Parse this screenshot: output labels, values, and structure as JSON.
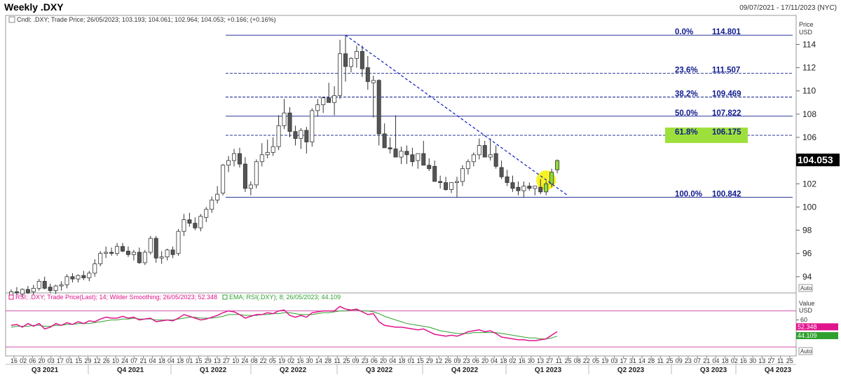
{
  "header": {
    "title": "Weekly .DXY",
    "date_range": "09/07/2021 - 17/11/2023 (NYC)"
  },
  "chart_data": [
    {
      "type": "candlestick",
      "legend": "Cndl; .DXY; Trade Price; 26/05/2023; 103.193; 104.061; 102.964; 104.053; +0.166; (+0.16%)",
      "axis_title": [
        "Price",
        "USD"
      ],
      "yticks": [
        94,
        96,
        98,
        100,
        102,
        104,
        106,
        108,
        110,
        112,
        114
      ],
      "ylim": [
        92.6,
        116.5
      ],
      "auto_label": "Auto",
      "last_price": {
        "label": "104.053",
        "value": 104.053
      },
      "candles": [
        [
          92.3,
          92.9,
          92.1,
          92.7
        ],
        [
          92.7,
          93.1,
          92.4,
          92.6
        ],
        [
          92.5,
          93.0,
          92.2,
          92.9
        ],
        [
          92.9,
          93.2,
          92.5,
          92.6
        ],
        [
          92.7,
          93.3,
          92.4,
          93.0
        ],
        [
          93.0,
          93.8,
          92.8,
          93.6
        ],
        [
          93.6,
          94.0,
          92.9,
          93.0
        ],
        [
          93.1,
          93.4,
          92.6,
          92.8
        ],
        [
          92.8,
          93.3,
          92.5,
          93.2
        ],
        [
          93.2,
          93.6,
          92.8,
          93.3
        ],
        [
          93.3,
          94.2,
          93.0,
          94.0
        ],
        [
          94.0,
          94.3,
          93.5,
          93.8
        ],
        [
          93.8,
          94.2,
          93.5,
          94.1
        ],
        [
          94.1,
          94.5,
          93.7,
          93.9
        ],
        [
          93.9,
          94.5,
          93.6,
          94.3
        ],
        [
          94.3,
          95.5,
          94.0,
          95.1
        ],
        [
          95.1,
          96.2,
          94.9,
          96.0
        ],
        [
          96.0,
          96.6,
          95.6,
          96.1
        ],
        [
          96.1,
          96.5,
          95.8,
          96.0
        ],
        [
          96.0,
          96.9,
          95.8,
          96.6
        ],
        [
          96.6,
          96.9,
          96.1,
          96.2
        ],
        [
          96.2,
          96.6,
          95.7,
          95.9
        ],
        [
          95.9,
          96.3,
          95.4,
          96.1
        ],
        [
          96.1,
          96.5,
          95.1,
          95.2
        ],
        [
          95.2,
          96.3,
          95.0,
          96.1
        ],
        [
          96.1,
          97.5,
          95.9,
          97.3
        ],
        [
          97.3,
          97.5,
          95.2,
          95.6
        ],
        [
          95.6,
          96.2,
          95.1,
          95.7
        ],
        [
          95.7,
          96.4,
          95.4,
          96.3
        ],
        [
          96.3,
          96.6,
          95.6,
          95.9
        ],
        [
          96.0,
          98.1,
          95.8,
          97.9
        ],
        [
          97.9,
          99.4,
          97.5,
          98.9
        ],
        [
          98.9,
          99.5,
          98.3,
          98.6
        ],
        [
          98.6,
          99.1,
          98.0,
          98.2
        ],
        [
          98.2,
          99.4,
          97.9,
          99.2
        ],
        [
          99.1,
          100.0,
          98.7,
          99.8
        ],
        [
          99.8,
          100.9,
          99.5,
          100.6
        ],
        [
          100.6,
          101.8,
          100.3,
          101.1
        ],
        [
          101.2,
          103.7,
          101.0,
          103.6
        ],
        [
          103.6,
          104.4,
          103.0,
          104.0
        ],
        [
          104.0,
          105.0,
          103.5,
          104.6
        ],
        [
          104.6,
          105.1,
          103.4,
          103.7
        ],
        [
          103.7,
          104.3,
          101.3,
          101.6
        ],
        [
          101.6,
          102.2,
          101.0,
          101.9
        ],
        [
          101.9,
          104.1,
          101.6,
          103.9
        ],
        [
          103.9,
          105.5,
          103.5,
          104.5
        ],
        [
          104.5,
          105.8,
          104.2,
          104.7
        ],
        [
          104.7,
          106.0,
          104.4,
          105.2
        ],
        [
          105.2,
          107.9,
          104.9,
          107.0
        ],
        [
          107.0,
          109.3,
          106.7,
          108.1
        ],
        [
          108.1,
          108.6,
          106.0,
          106.5
        ],
        [
          106.5,
          107.0,
          105.3,
          105.9
        ],
        [
          105.9,
          106.8,
          105.0,
          106.6
        ],
        [
          106.6,
          106.9,
          104.6,
          105.6
        ],
        [
          105.6,
          108.5,
          105.2,
          108.3
        ],
        [
          108.3,
          109.3,
          107.8,
          108.8
        ],
        [
          108.8,
          109.5,
          108.1,
          109.4
        ],
        [
          109.4,
          110.7,
          109.1,
          109.0
        ],
        [
          109.0,
          110.4,
          107.9,
          109.6
        ],
        [
          109.6,
          114.4,
          109.3,
          113.2
        ],
        [
          113.2,
          114.8,
          110.8,
          112.1
        ],
        [
          112.1,
          112.9,
          111.6,
          112.8
        ],
        [
          112.8,
          113.9,
          112.0,
          113.4
        ],
        [
          113.4,
          113.9,
          111.2,
          111.9
        ],
        [
          112.0,
          113.0,
          110.1,
          110.8
        ],
        [
          110.7,
          111.3,
          107.7,
          110.9
        ],
        [
          110.9,
          111.0,
          105.3,
          106.3
        ],
        [
          106.3,
          107.2,
          105.8,
          105.1
        ],
        [
          105.1,
          106.0,
          104.6,
          105.0
        ],
        [
          105.0,
          107.9,
          104.7,
          104.3
        ],
        [
          104.3,
          105.2,
          103.7,
          104.8
        ],
        [
          104.8,
          105.3,
          103.7,
          104.5
        ],
        [
          104.5,
          105.1,
          103.5,
          103.9
        ],
        [
          104.0,
          104.6,
          103.3,
          104.6
        ],
        [
          104.6,
          105.7,
          103.6,
          103.6
        ],
        [
          103.6,
          104.2,
          103.1,
          103.3
        ],
        [
          103.5,
          104.0,
          102.9,
          102.2
        ],
        [
          102.2,
          102.7,
          101.6,
          102.1
        ],
        [
          102.1,
          102.6,
          101.4,
          101.5
        ],
        [
          101.5,
          102.1,
          101.2,
          102.1
        ],
        [
          102.1,
          102.6,
          100.8,
          102.2
        ],
        [
          102.2,
          103.6,
          101.8,
          103.3
        ],
        [
          103.3,
          104.1,
          102.8,
          103.9
        ],
        [
          103.9,
          104.7,
          103.5,
          104.5
        ],
        [
          104.5,
          105.9,
          104.1,
          105.3
        ],
        [
          105.3,
          105.7,
          104.9,
          104.3
        ],
        [
          104.3,
          105.9,
          104.0,
          104.5
        ],
        [
          104.6,
          105.3,
          103.3,
          103.5
        ],
        [
          103.4,
          104.0,
          102.4,
          102.6
        ],
        [
          102.6,
          103.2,
          101.8,
          102.1
        ],
        [
          102.1,
          102.7,
          101.3,
          101.6
        ],
        [
          101.7,
          102.2,
          101.0,
          101.4
        ],
        [
          101.4,
          102.2,
          100.8,
          101.8
        ],
        [
          101.8,
          102.1,
          101.4,
          101.6
        ],
        [
          101.6,
          101.8,
          101.0,
          101.8
        ],
        [
          101.7,
          102.4,
          101.1,
          101.3
        ],
        [
          101.3,
          102.2,
          101.0,
          102.0
        ],
        [
          102.0,
          103.3,
          101.7,
          103.0
        ],
        [
          103.2,
          104.1,
          102.9,
          104.0
        ]
      ],
      "candle_colors": {
        "up": "#ffffff",
        "down": "#555555",
        "wick": "#333333",
        "recent_up": "#8ed93b"
      },
      "fibonacci": {
        "color": "#0f1b8c",
        "levels": [
          {
            "label": "0.0%",
            "value_label": "114.801",
            "value": 114.801,
            "style": "solid"
          },
          {
            "label": "23.6%",
            "value_label": "111.507",
            "value": 111.507,
            "style": "dashed"
          },
          {
            "label": "38.2%",
            "value_label": "109.469",
            "value": 109.469,
            "style": "dashed"
          },
          {
            "label": "50.0%",
            "value_label": "107.822",
            "value": 107.822,
            "style": "solid"
          },
          {
            "label": "61.8%",
            "value_label": "106.175",
            "value": 106.175,
            "style": "dashed",
            "highlight": "#9ee03b"
          },
          {
            "label": "100.0%",
            "value_label": "100.842",
            "value": 100.842,
            "style": "solid"
          }
        ]
      },
      "trendline": {
        "from": {
          "bar": 60,
          "value": 114.8
        },
        "to": {
          "bar": 100,
          "value": 100.95
        },
        "color": "#1a2ac0"
      },
      "highlight_circle": {
        "bar": 96,
        "value": 102.3,
        "color": "#f4f000"
      }
    },
    {
      "type": "line",
      "legend_rsi": "RSI; .DXY; Trade Price(Last); 14; Wilder Smoothing; 26/05/2023; 52.348",
      "legend_ema": "EMA; RSI(.DXY); 8; 26/05/2023; 44.109",
      "axis_title": [
        "Value",
        "USD"
      ],
      "ytick": 60,
      "ylim": [
        20,
        90
      ],
      "reference_lines": [
        70,
        30
      ],
      "reference_color": "#c01890",
      "auto_label": "Auto",
      "series": [
        {
          "name": "RSI",
          "color": "#e0148c",
          "last_label": "52.348",
          "values": [
            54,
            55,
            52,
            56,
            53,
            56,
            50,
            52,
            56,
            54,
            57,
            55,
            58,
            56,
            59,
            58,
            61,
            63,
            62,
            62,
            64,
            62,
            63,
            60,
            61,
            62,
            58,
            59,
            60,
            59,
            62,
            66,
            64,
            62,
            60,
            61,
            63,
            65,
            68,
            70,
            69,
            66,
            62,
            64,
            66,
            66,
            68,
            67,
            70,
            71,
            65,
            63,
            65,
            63,
            68,
            69,
            70,
            70,
            70,
            75,
            72,
            71,
            72,
            69,
            66,
            67,
            58,
            54,
            53,
            52,
            52,
            51,
            50,
            49,
            50,
            47,
            44,
            43,
            42,
            43,
            42,
            44,
            47,
            48,
            49,
            47,
            48,
            45,
            41,
            40,
            39,
            38,
            38,
            37,
            37,
            38,
            39,
            43,
            47
          ]
        },
        {
          "name": "EMA",
          "color": "#2fa02f",
          "last_label": "44.109",
          "values": [
            52,
            53,
            53,
            53,
            54,
            54,
            53,
            53,
            54,
            54,
            55,
            55,
            56,
            56,
            56,
            57,
            58,
            59,
            60,
            60,
            61,
            61,
            62,
            61,
            61,
            61,
            60,
            60,
            60,
            60,
            61,
            62,
            63,
            63,
            62,
            62,
            62,
            63,
            64,
            66,
            66,
            66,
            65,
            65,
            65,
            66,
            66,
            67,
            67,
            68,
            68,
            67,
            66,
            66,
            66,
            67,
            68,
            68,
            69,
            70,
            70,
            71,
            71,
            70,
            70,
            69,
            67,
            64,
            62,
            60,
            58,
            56,
            55,
            54,
            53,
            52,
            50,
            48,
            47,
            46,
            45,
            45,
            45,
            46,
            46,
            46,
            46,
            46,
            45,
            44,
            43,
            42,
            41,
            40,
            40,
            39,
            39,
            40,
            42
          ]
        }
      ]
    }
  ],
  "x_axis": {
    "labels": [
      "16",
      "02",
      "06",
      "20",
      "03",
      "17",
      "01",
      "15",
      "29",
      "12",
      "26",
      "10",
      "24",
      "07",
      "21",
      "04",
      "18",
      "04",
      "18",
      "01",
      "15",
      "29",
      "13",
      "27",
      "10",
      "24",
      "08",
      "22",
      "05",
      "19",
      "02",
      "16",
      "30",
      "14",
      "28",
      "11",
      "25",
      "09",
      "23",
      "06",
      "20",
      "04",
      "18",
      "01",
      "15",
      "29",
      "12",
      "26",
      "09",
      "23",
      "06",
      "20",
      "04",
      "18",
      "02",
      "16",
      "30",
      "13",
      "27",
      "11",
      "25",
      "08",
      "22",
      "05",
      "19",
      "03",
      "17",
      "31",
      "14",
      "28",
      "11",
      "25",
      "09",
      "23",
      "07",
      "21",
      "04",
      "18",
      "02",
      "16",
      "30",
      "13",
      "27",
      "11",
      "25"
    ],
    "quarters": [
      "Q3 2021",
      "Q4 2021",
      "Q1 2022",
      "Q2 2022",
      "Q3 2022",
      "Q4 2022",
      "Q1 2023",
      "Q2 2023",
      "Q3 2023",
      "Q4 2023"
    ]
  }
}
